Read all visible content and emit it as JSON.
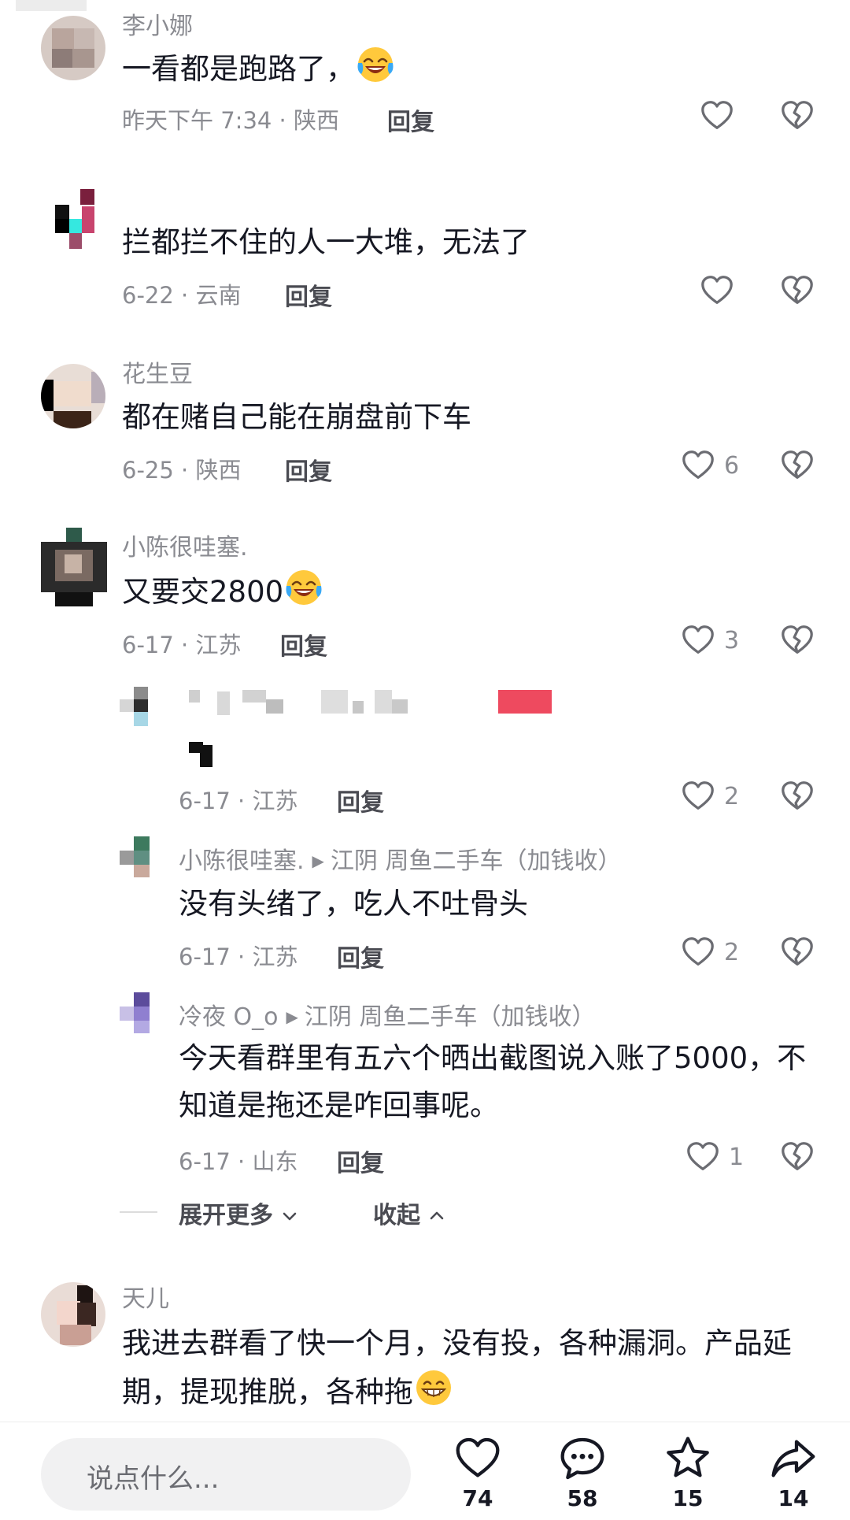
{
  "comments": [
    {
      "user": "李小娜",
      "text": "一看都是跑路了，",
      "meta": "昨天下午 7:34 · 陕西",
      "reply": "回复",
      "likes": ""
    },
    {
      "user": "",
      "text": "拦都拦不住的人一大堆，无法了",
      "meta": "6-22 · 云南",
      "reply": "回复",
      "likes": ""
    },
    {
      "user": "花生豆",
      "text": "都在赌自己能在崩盘前下车",
      "meta": "6-25 · 陕西",
      "reply": "回复",
      "likes": "6"
    },
    {
      "user": "小陈很哇塞.",
      "text": "又要交2800",
      "meta": "6-17 · 江苏",
      "reply": "回复",
      "likes": "3"
    }
  ],
  "replies": [
    {
      "user": "",
      "target": "",
      "text": "",
      "meta": "6-17 · 江苏",
      "reply": "回复",
      "likes": "2"
    },
    {
      "user": "小陈很哇塞.",
      "target": "江阴 周鱼二手车（加钱收）",
      "text": "没有头绪了，吃人不吐骨头",
      "meta": "6-17 · 江苏",
      "reply": "回复",
      "likes": "2"
    },
    {
      "user": "冷夜 O_o",
      "target": "江阴 周鱼二手车（加钱收）",
      "text_line1": "今天看群里有五六个晒出截图说入账了5000，不",
      "text_line2": "知道是拖还是咋回事呢。",
      "meta": "6-17 · 山东",
      "reply": "回复",
      "likes": "1"
    }
  ],
  "expand": {
    "more": "展开更多",
    "collapse": "收起"
  },
  "last_comment": {
    "user": "天儿",
    "text_line1": "我进去群看了快一个月，没有投，各种漏洞。产品延",
    "text_line2": "期，提现推脱，各种拖"
  },
  "bottom_bar": {
    "input_placeholder": "说点什么...",
    "like_count": "74",
    "comment_count": "58",
    "favorite_count": "15",
    "share_count": "14"
  },
  "icons": [
    "heart-icon",
    "broken-heart-icon",
    "laugh-cry-emoji",
    "grin-emoji",
    "comment-icon",
    "star-icon",
    "share-icon",
    "chevron-down-icon",
    "chevron-up-icon",
    "reply-arrow-icon"
  ]
}
